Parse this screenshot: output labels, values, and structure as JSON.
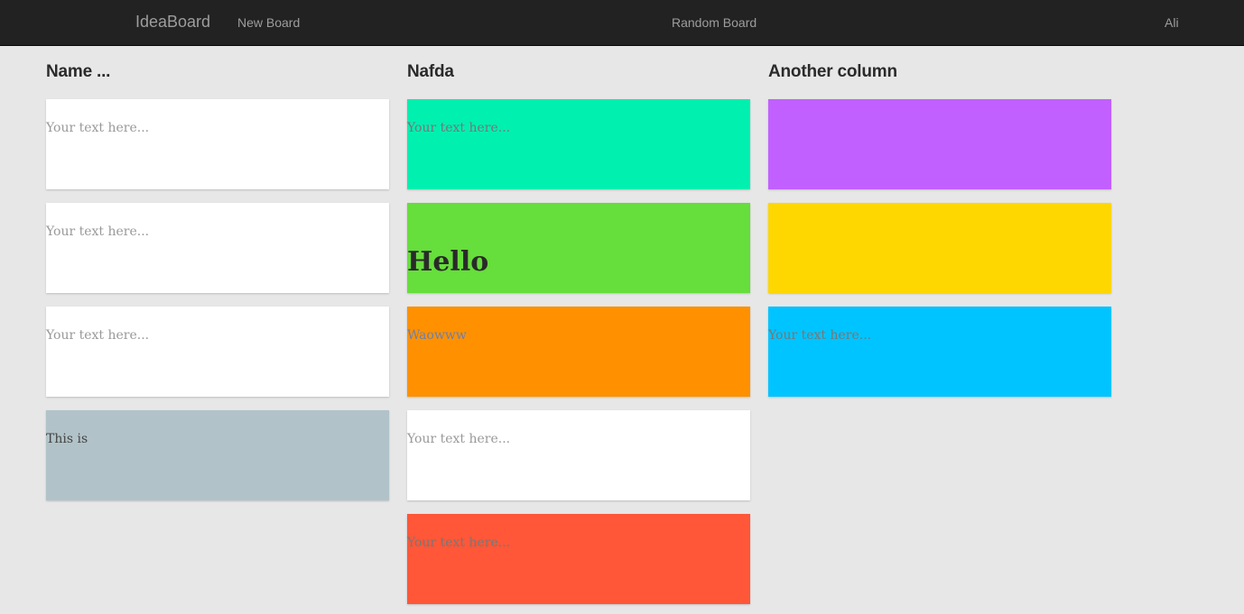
{
  "navbar": {
    "brand": "IdeaBoard",
    "new_board": "New Board",
    "random_board": "Random Board",
    "user": "Ali"
  },
  "columns": [
    {
      "title": "Name ...",
      "cards": [
        {
          "text": "Your text here...",
          "color": "#ffffff"
        },
        {
          "text": "Your text here...",
          "color": "#ffffff"
        },
        {
          "text": "Your text here...",
          "color": "#ffffff"
        },
        {
          "text": "This is",
          "color": "#b1c3c8"
        }
      ]
    },
    {
      "title": "Nafda",
      "cards": [
        {
          "text": "Your text here...",
          "color": "#00f0b0"
        },
        {
          "text": "Hello",
          "color": "#66de3b"
        },
        {
          "text": "Waowww",
          "color": "#ff9100"
        },
        {
          "text": "Your text here...",
          "color": "#ffffff"
        },
        {
          "text": "Your text here...",
          "color": "#ff5738"
        }
      ]
    },
    {
      "title": "Another column",
      "cards": [
        {
          "text": "",
          "color": "#c160ff"
        },
        {
          "text": "",
          "color": "#ffd700"
        },
        {
          "text": "Your text here...",
          "color": "#00c4ff"
        }
      ]
    }
  ]
}
